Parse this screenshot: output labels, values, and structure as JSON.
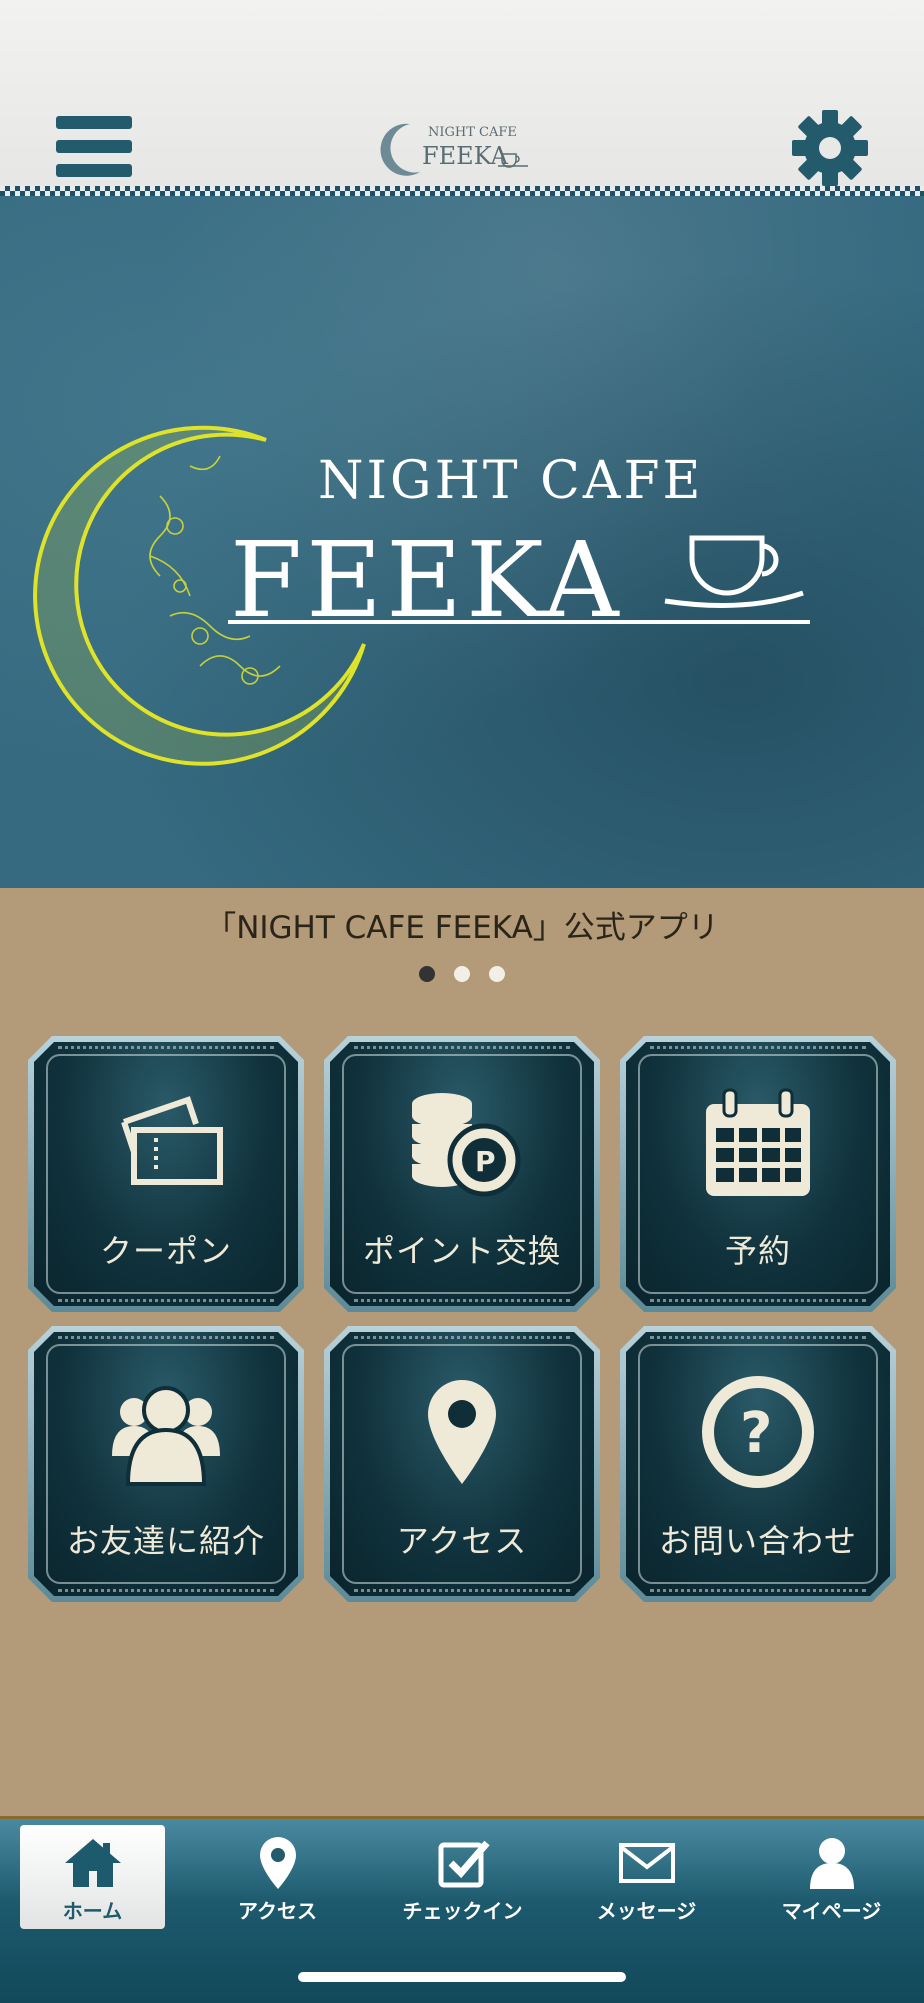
{
  "header": {
    "logo_small_top": "NIGHT CAFE",
    "logo_small_main": "FEEKA"
  },
  "banner": {
    "logo_top": "NIGHT CAFE",
    "logo_main": "FEEKA"
  },
  "caption": "「NIGHT CAFE FEEKA」公式アプリ",
  "carousel": {
    "pages": 3,
    "active": 1
  },
  "tiles": [
    {
      "label": "クーポン",
      "icon": "ticket-icon"
    },
    {
      "label": "ポイント交換",
      "icon": "coins-point-icon"
    },
    {
      "label": "予約",
      "icon": "calendar-icon"
    },
    {
      "label": "お友達に紹介",
      "icon": "people-group-icon"
    },
    {
      "label": "アクセス",
      "icon": "map-pin-icon"
    },
    {
      "label": "お問い合わせ",
      "icon": "question-circle-icon"
    }
  ],
  "tabbar": [
    {
      "label": "ホーム",
      "icon": "home-icon",
      "active": true
    },
    {
      "label": "アクセス",
      "icon": "map-pin-icon"
    },
    {
      "label": "チェックイン",
      "icon": "checkbox-icon"
    },
    {
      "label": "メッセージ",
      "icon": "envelope-icon"
    },
    {
      "label": "マイページ",
      "icon": "user-icon"
    }
  ],
  "colors": {
    "primary": "#235a6c",
    "moon": "#dfe32a",
    "tile_text": "#efe9d8",
    "burlap": "#b39a78"
  }
}
